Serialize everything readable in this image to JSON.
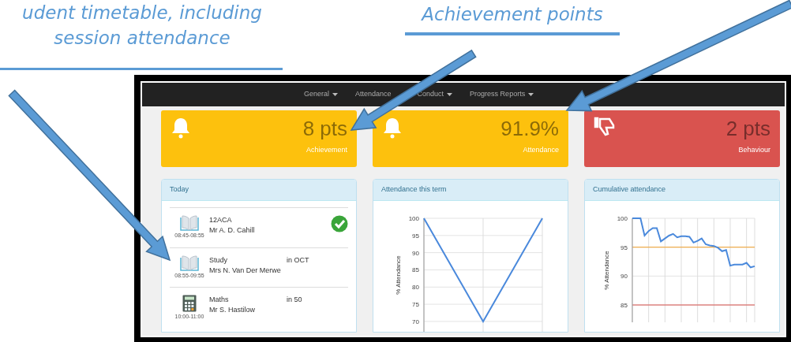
{
  "annotations": [
    {
      "lines": [
        "udent timetable, including",
        "session attendance"
      ]
    },
    {
      "lines": [
        "Achievement points"
      ]
    }
  ],
  "nav": [
    {
      "label": "General",
      "caret": true
    },
    {
      "label": "Attendance",
      "caret": false
    },
    {
      "label": "Conduct",
      "caret": true
    },
    {
      "label": "Progress Reports",
      "caret": true
    }
  ],
  "cards": [
    {
      "kind": "bell",
      "value": "8 pts",
      "label": "Achievement",
      "color": "#fdc10d"
    },
    {
      "kind": "bell",
      "value": "91.9%",
      "label": "Attendance",
      "color": "#fdc10d"
    },
    {
      "kind": "thumbs-down",
      "value": "2 pts",
      "label": "Behaviour",
      "color": "#d9534f"
    }
  ],
  "today": {
    "title": "Today",
    "lessons": [
      {
        "kind": "book",
        "time": "08:45-08:55",
        "subject": "12ACA",
        "teacher": "Mr A. D. Cahill",
        "attended": true
      },
      {
        "kind": "book",
        "time": "08:55-09:55",
        "subject": "Study",
        "teacher": "Mrs N. Van Der Merwe",
        "room": "in OCT",
        "attended": false
      },
      {
        "kind": "calculator",
        "time": "10:00-11:00",
        "subject": "Maths",
        "teacher": "Mr S. Hastilow",
        "room": "in 50",
        "attended": false
      }
    ]
  },
  "term_panel": {
    "title": "Attendance this term",
    "chart_data": {
      "type": "line",
      "ylabel": "% Attendance",
      "grid": true,
      "series": [
        {
          "color": "#4a89dc",
          "values": [
            100,
            70,
            100
          ]
        }
      ],
      "yticks": [
        70,
        75,
        80,
        85,
        90,
        95,
        100
      ],
      "ylim": [
        67,
        100
      ]
    }
  },
  "cumulative_panel": {
    "title": "Cumulative attendance",
    "chart_data": {
      "type": "line",
      "ylabel": "% Attendance",
      "grid": true,
      "series": [
        {
          "color": "#4a89dc",
          "values": [
            100,
            100,
            100,
            97,
            97.8,
            98.3,
            98.3,
            96,
            96.5,
            97,
            97.3,
            96.7,
            96.9,
            96.9,
            96.8,
            95.8,
            96.1,
            96.5,
            95.5,
            95.3,
            95.2,
            94.9,
            94.3,
            94.5,
            91.8,
            92,
            92,
            92,
            92.3,
            91.5,
            91.7
          ]
        },
        {
          "color": "#f0ad4e",
          "values": [
            95,
            95,
            95,
            95,
            95,
            95,
            95,
            95,
            95,
            95,
            95,
            95,
            95,
            95,
            95,
            95,
            95,
            95,
            95,
            95,
            95,
            95,
            95,
            95,
            95,
            95,
            95,
            95,
            95,
            95,
            95
          ]
        },
        {
          "color": "#d9534f",
          "values": [
            85,
            85,
            85,
            85,
            85,
            85,
            85,
            85,
            85,
            85,
            85,
            85,
            85,
            85,
            85,
            85,
            85,
            85,
            85,
            85,
            85,
            85,
            85,
            85,
            85,
            85,
            85,
            85,
            85,
            85,
            85
          ]
        }
      ],
      "yticks": [
        85,
        90,
        95,
        100
      ],
      "ylim": [
        82,
        100
      ]
    }
  }
}
